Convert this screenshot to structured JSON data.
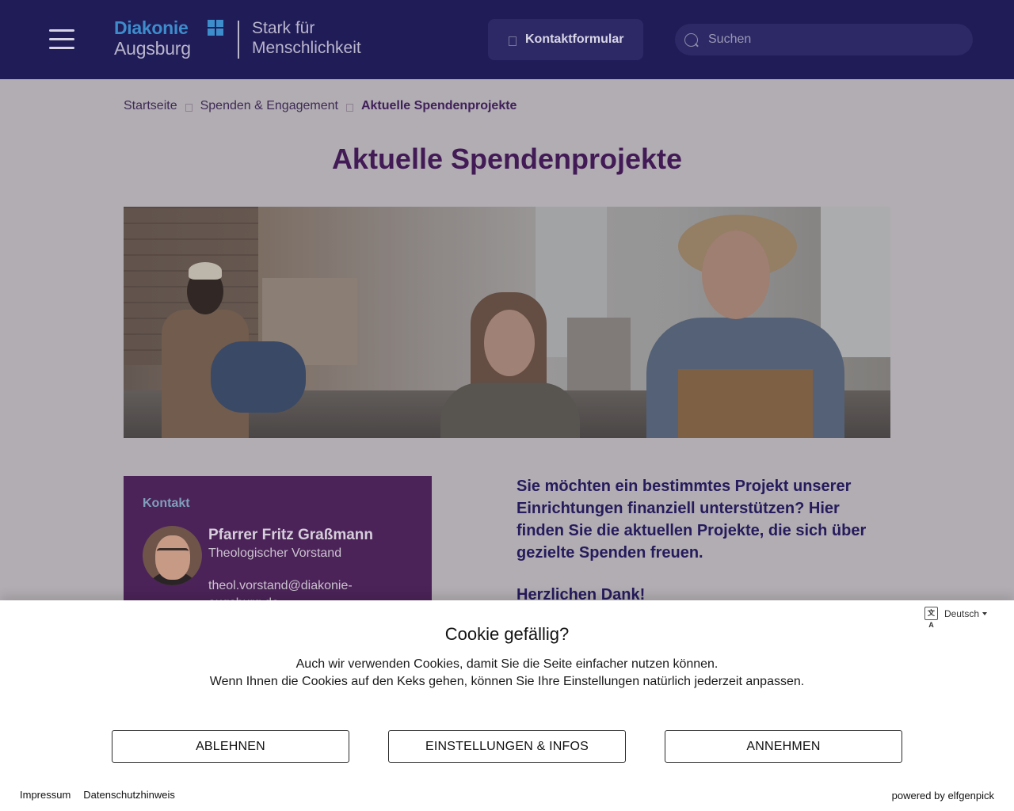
{
  "header": {
    "logo": {
      "name": "Diakonie",
      "city": "Augsburg",
      "tagline_line1": "Stark für",
      "tagline_line2": "Menschlichkeit",
      "brand_color": "#3d8ccc"
    },
    "contact_button": "Kontaktformular",
    "search_placeholder": "Suchen",
    "background": "#201c58"
  },
  "breadcrumb": [
    "Startseite",
    "Spenden & Engagement",
    "Aktuelle Spendenprojekte"
  ],
  "page": {
    "title": "Aktuelle Spendenprojekte",
    "intro": "Sie möchten ein bestimmtes Projekt unserer Einrichtungen finanziell unterstützen? Hier finden Sie die aktuellen Projekte, die sich über gezielte Spenden freuen.",
    "thanks": "Herzlichen Dank!"
  },
  "contact_card": {
    "title": "Kontakt",
    "name": "Pfarrer Fritz Graßmann",
    "role": "Theologischer Vorstand",
    "email": "theol.vorstand@diakonie-augsburg.de"
  },
  "cookie_banner": {
    "language": "Deutsch",
    "title": "Cookie gefällig?",
    "text_line1": "Auch wir verwenden Cookies, damit Sie die Seite einfacher nutzen können.",
    "text_line2": "Wenn Ihnen die Cookies auf den Keks gehen, können Sie Ihre Einstellungen natürlich jederzeit anpassen.",
    "buttons": {
      "decline": "ABLEHNEN",
      "settings": "EINSTELLUNGEN & INFOS",
      "accept": "ANNEHMEN"
    },
    "links": {
      "imprint": "Impressum",
      "privacy": "Datenschutzhinweis"
    },
    "powered_by": "powered by elfgenpick"
  }
}
